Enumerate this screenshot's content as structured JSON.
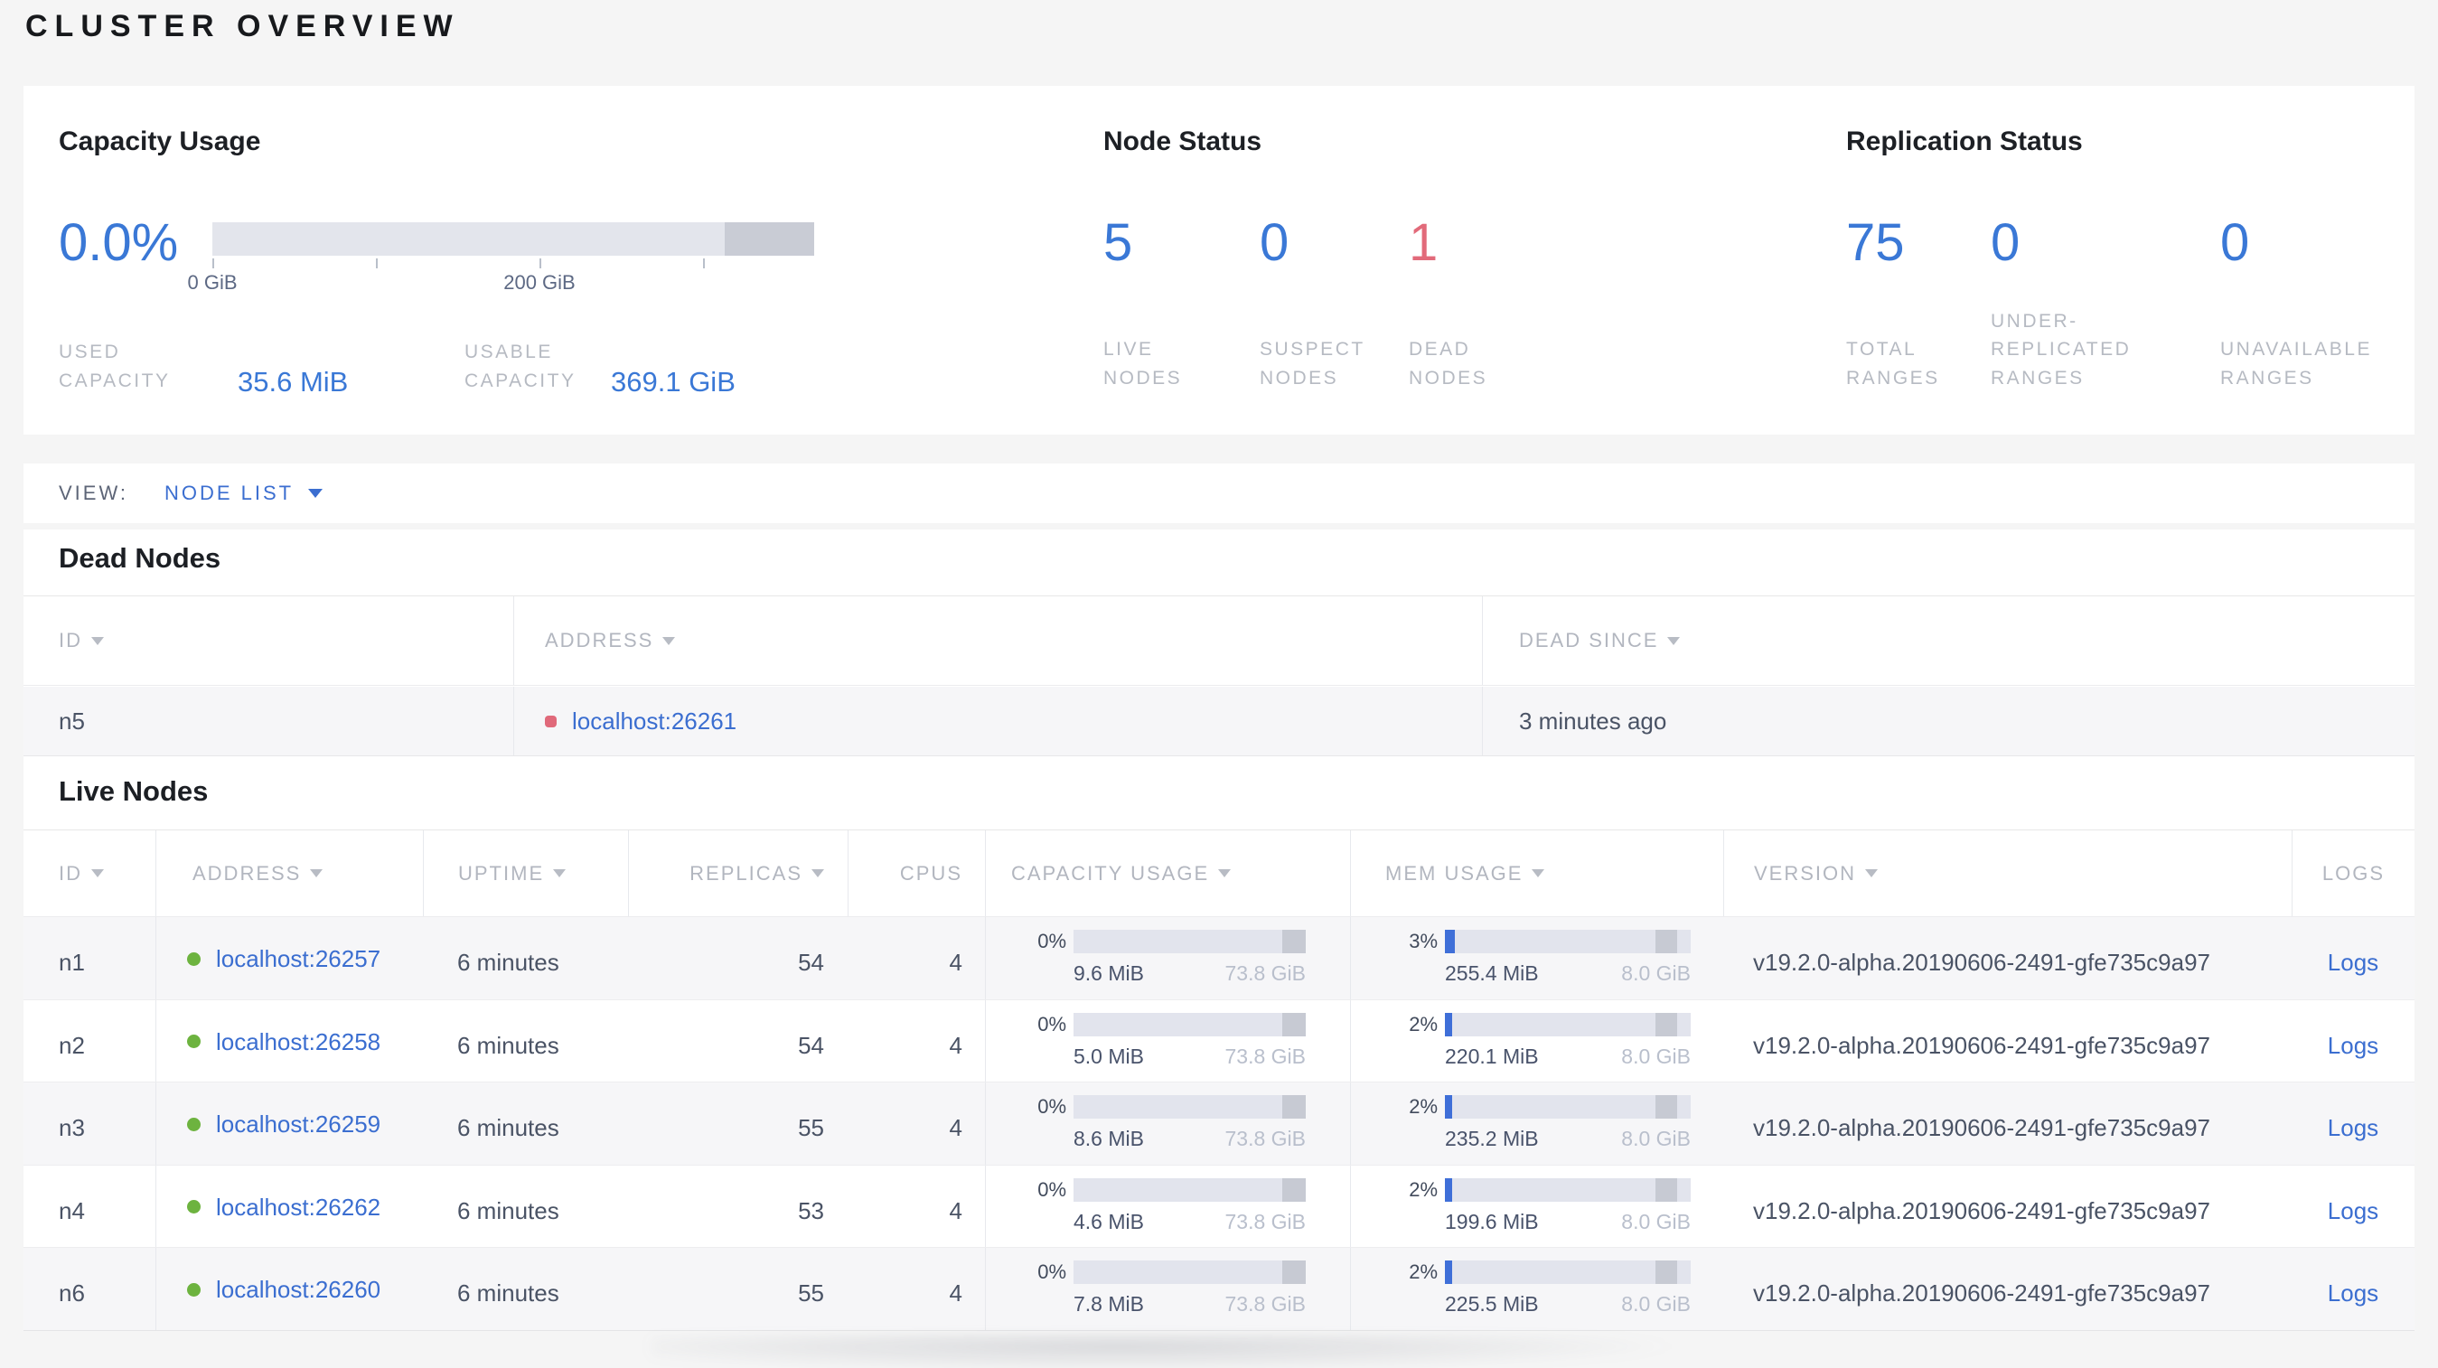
{
  "page": {
    "title": "CLUSTER OVERVIEW"
  },
  "colors": {
    "accent_blue": "#3a78d6",
    "link_blue": "#3b6ed0",
    "danger_red": "#e26a7a",
    "live_green": "#6db33f",
    "bar_track": "#e2e4ed",
    "bar_dark": "#c7cad3"
  },
  "summary": {
    "capacity": {
      "title": "Capacity Usage",
      "percent": "0.0%",
      "axis_tick_labels": [
        "0 GiB",
        "200 GiB"
      ],
      "used_label": "USED CAPACITY",
      "used_value": "35.6 MiB",
      "usable_label": "USABLE CAPACITY",
      "usable_value": "369.1 GiB"
    },
    "node_status": {
      "title": "Node Status",
      "metrics": [
        {
          "value": "5",
          "label": "LIVE NODES",
          "tone": "blue"
        },
        {
          "value": "0",
          "label": "SUSPECT NODES",
          "tone": "blue"
        },
        {
          "value": "1",
          "label": "DEAD NODES",
          "tone": "red"
        }
      ]
    },
    "replication": {
      "title": "Replication Status",
      "metrics": [
        {
          "value": "75",
          "label": "TOTAL RANGES"
        },
        {
          "value": "0",
          "label": "UNDER-REPLICATED RANGES"
        },
        {
          "value": "0",
          "label": "UNAVAILABLE RANGES"
        }
      ]
    }
  },
  "view_bar": {
    "label": "VIEW:",
    "selected": "NODE LIST"
  },
  "dead_nodes": {
    "title": "Dead Nodes",
    "columns": [
      {
        "label": "ID",
        "sortable": true
      },
      {
        "label": "ADDRESS",
        "sortable": true
      },
      {
        "label": "DEAD SINCE",
        "sortable": true
      }
    ],
    "rows": [
      {
        "id": "n5",
        "address": "localhost:26261",
        "dead_since": "3 minutes ago"
      }
    ]
  },
  "live_nodes": {
    "title": "Live Nodes",
    "columns": [
      {
        "label": "ID",
        "sortable": true
      },
      {
        "label": "ADDRESS",
        "sortable": true
      },
      {
        "label": "UPTIME",
        "sortable": true
      },
      {
        "label": "REPLICAS",
        "sortable": true
      },
      {
        "label": "CPUS",
        "sortable": false
      },
      {
        "label": "CAPACITY USAGE",
        "sortable": true
      },
      {
        "label": "MEM USAGE",
        "sortable": true
      },
      {
        "label": "VERSION",
        "sortable": true
      },
      {
        "label": "LOGS",
        "sortable": false
      }
    ],
    "rows": [
      {
        "id": "n1",
        "address": "localhost:26257",
        "uptime": "6 minutes",
        "replicas": "54",
        "cpus": "4",
        "capacity_pct": "0%",
        "capacity_used": "9.6 MiB",
        "capacity_total": "73.8 GiB",
        "mem_pct": "3%",
        "mem_used": "255.4 MiB",
        "mem_total": "8.0 GiB",
        "version": "v19.2.0-alpha.20190606-2491-gfe735c9a97",
        "logs": "Logs"
      },
      {
        "id": "n2",
        "address": "localhost:26258",
        "uptime": "6 minutes",
        "replicas": "54",
        "cpus": "4",
        "capacity_pct": "0%",
        "capacity_used": "5.0 MiB",
        "capacity_total": "73.8 GiB",
        "mem_pct": "2%",
        "mem_used": "220.1 MiB",
        "mem_total": "8.0 GiB",
        "version": "v19.2.0-alpha.20190606-2491-gfe735c9a97",
        "logs": "Logs"
      },
      {
        "id": "n3",
        "address": "localhost:26259",
        "uptime": "6 minutes",
        "replicas": "55",
        "cpus": "4",
        "capacity_pct": "0%",
        "capacity_used": "8.6 MiB",
        "capacity_total": "73.8 GiB",
        "mem_pct": "2%",
        "mem_used": "235.2 MiB",
        "mem_total": "8.0 GiB",
        "version": "v19.2.0-alpha.20190606-2491-gfe735c9a97",
        "logs": "Logs"
      },
      {
        "id": "n4",
        "address": "localhost:26262",
        "uptime": "6 minutes",
        "replicas": "53",
        "cpus": "4",
        "capacity_pct": "0%",
        "capacity_used": "4.6 MiB",
        "capacity_total": "73.8 GiB",
        "mem_pct": "2%",
        "mem_used": "199.6 MiB",
        "mem_total": "8.0 GiB",
        "version": "v19.2.0-alpha.20190606-2491-gfe735c9a97",
        "logs": "Logs"
      },
      {
        "id": "n6",
        "address": "localhost:26260",
        "uptime": "6 minutes",
        "replicas": "55",
        "cpus": "4",
        "capacity_pct": "0%",
        "capacity_used": "7.8 MiB",
        "capacity_total": "73.8 GiB",
        "mem_pct": "2%",
        "mem_used": "225.5 MiB",
        "mem_total": "8.0 GiB",
        "version": "v19.2.0-alpha.20190606-2491-gfe735c9a97",
        "logs": "Logs"
      }
    ]
  }
}
